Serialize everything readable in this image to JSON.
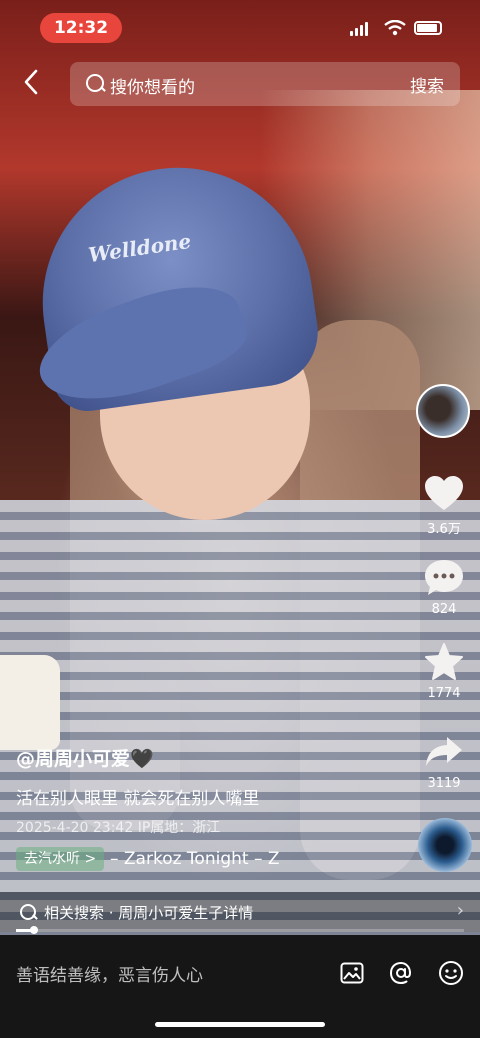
{
  "status_bar": {
    "time": "12:32"
  },
  "search": {
    "placeholder": "搜你想看的",
    "button": "搜索"
  },
  "video": {
    "cap_text": "Welldone"
  },
  "actions": {
    "like_count": "3.6万",
    "comment_count": "824",
    "favorite_count": "1774",
    "share_count": "3119"
  },
  "post": {
    "author": "@周周小可爱🖤",
    "caption": "活在别人眼里 就会死在别人嘴里",
    "date": "2025-4-20 23:42",
    "location_label": "IP属地：浙江",
    "music_pill": "去汽水听 >",
    "music": "– Zarkoz   Tonight – Z"
  },
  "related": {
    "text": "相关搜索 · 周周小可爱生子详情"
  },
  "playback": {
    "progress": 0.04
  },
  "comment_bar": {
    "placeholder": "善语结善缘，恶言伤人心"
  }
}
